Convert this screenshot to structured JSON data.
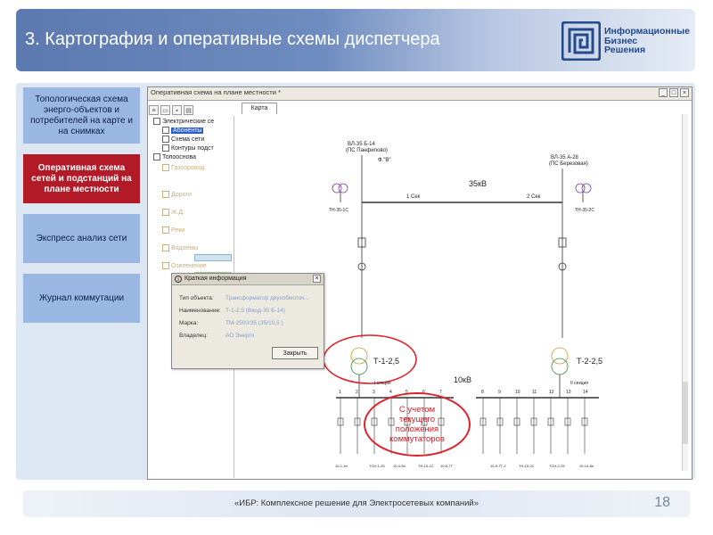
{
  "header": {
    "title": "3. Картография и оперативные схемы диспетчера"
  },
  "logo": {
    "lines": [
      "Информационные",
      "Бизнес",
      "Решения"
    ],
    "color": "#244a8a"
  },
  "sidebar": {
    "items": [
      {
        "label": "Топологическая схема энерго-объектов и потребителей на карте и на снимках",
        "active": false
      },
      {
        "label": "Оперативная схема сетей и подстанций на плане местности",
        "active": true
      },
      {
        "label": "Экспресс анализ сети",
        "active": false
      },
      {
        "label": "Журнал коммутации",
        "active": false
      }
    ]
  },
  "app": {
    "window_title": "Оперативная схема на плане местности *",
    "tab_label": "Карта",
    "tree": [
      {
        "label": "Электрические се",
        "dim": false
      },
      {
        "label": "Абоненты",
        "dim": false,
        "selected": true
      },
      {
        "label": "Схема сети",
        "dim": false
      },
      {
        "label": "Контуры подст",
        "dim": false
      },
      {
        "label": "Топооснова",
        "dim": false
      },
      {
        "label": "Газопровод",
        "dim": true
      },
      {
        "label": "Дороги",
        "dim": true
      },
      {
        "label": "Ж.Д.",
        "dim": true
      },
      {
        "label": "Реки",
        "dim": true
      },
      {
        "label": "Водоемы",
        "dim": true
      },
      {
        "label": "Озеленение",
        "dim": true
      }
    ],
    "diagram": {
      "line1_name": "ВЛ-35 Б-14",
      "line1_sub": "(ПС Панфилово)",
      "line2_name": "ВЛ-35 А-28",
      "line2_sub": "(ПС Березовая)",
      "bus35_label": "35кВ",
      "section1": "1 Сек",
      "section2": "2 Сек",
      "phase_label": "Ф.\"В\"",
      "tn1": "ТН-35-1С",
      "tn2": "ТН-35-2С",
      "t1": "Т-1-2,5",
      "t2": "Т-2-2,5",
      "bus10_label": "10кВ",
      "sec1_low": "I секция",
      "sec2_low": "II секция",
      "cell_numbers": [
        "1",
        "2",
        "3",
        "4",
        "5",
        "6",
        "7",
        "8",
        "9",
        "10",
        "11",
        "12",
        "13",
        "14"
      ],
      "bottom_labels": [
        "10-1-4н",
        "ТСН-1-25",
        "10-4-5н",
        "ТН-10-1С",
        "10-6-7Т",
        "10-9-7Т-2",
        "ТН-10-2С",
        "ТСН-2-25",
        "10-14-8н"
      ]
    }
  },
  "popup": {
    "title": "Краткая информация",
    "rows": [
      {
        "label": "Тип объекта:",
        "value": "Трансформатор двухобмоточ..."
      },
      {
        "label": "Наименование:",
        "value": "Т-1-2,5 (Ввод-35 Б-14)"
      },
      {
        "label": "Марка:",
        "value": "ТМ-2500/35 (35/10,5 )"
      },
      {
        "label": "Владелец:",
        "value": "АО Энерго"
      }
    ],
    "close_button": "Закрыть"
  },
  "callout": {
    "text": "С учетом\nтекущего\nположения\nкоммутаторов",
    "color": "#d01c25"
  },
  "footer": {
    "text": "«ИБР: Комплексное решение для Электросетевых компаний»",
    "page_number": "18"
  }
}
